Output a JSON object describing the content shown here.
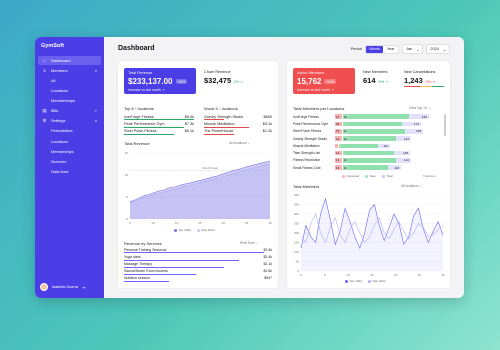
{
  "app": {
    "brand": "GymSoft",
    "page_title": "Dashboard"
  },
  "sidebar": {
    "items": [
      {
        "label": "Dashboard",
        "icon": "home-icon",
        "active": true
      },
      {
        "label": "Members",
        "icon": "users-icon",
        "chevron": "v"
      },
      {
        "label": "All",
        "sub": true
      },
      {
        "label": "Locations",
        "sub": true
      },
      {
        "label": "Memberships",
        "sub": true
      },
      {
        "label": "Bills",
        "icon": "file-icon",
        "chevron": ">"
      },
      {
        "label": "Settings",
        "icon": "gear-icon",
        "chevron": "v"
      },
      {
        "label": "Periodicities",
        "sub": true
      },
      {
        "label": "Locations",
        "sub": true
      },
      {
        "label": "Membeships",
        "sub": true
      },
      {
        "label": "Services",
        "sub": true
      },
      {
        "label": "Data feed",
        "sub": true
      }
    ],
    "user": {
      "name": "Isabella Guerra"
    }
  },
  "controls": {
    "period_label": "Period",
    "period_options": [
      "Month",
      "Year"
    ],
    "period_selected": "Month",
    "month_value": "Jan",
    "year_value": "2024"
  },
  "kpis_left": {
    "total_revenue": {
      "label": "Total Revenue",
      "value": "$233,137.00",
      "badge": "+32%",
      "sub": "Increase vs last month ↗"
    },
    "churn_revenue": {
      "label": "Churn Revenue",
      "value": "$32,475",
      "delta": "-2% ↘"
    }
  },
  "kpis_right": {
    "active_members": {
      "label": "Active Members",
      "value": "15,762",
      "badge": "+12%",
      "sub": "Increase vs last month ↗"
    },
    "new_members": {
      "label": "New Members",
      "value": "614",
      "delta": "+9% ↗"
    },
    "new_cancellations": {
      "label": "New Cancellations",
      "value": "1,243",
      "delta": "+6% ↗"
    }
  },
  "top_locations": {
    "title": "Top 5 ↑ locations",
    "rows": [
      {
        "name": "IronForge Fitness",
        "value": "$8.4k"
      },
      {
        "name": "Peak Performance Gym",
        "value": "$7.3k"
      },
      {
        "name": "Steel Pulse Fitness",
        "value": "$6.1k"
      }
    ]
  },
  "worst_locations": {
    "title": "Worst 5 ↓ locations",
    "rows": [
      {
        "name": "Gravity Strength Studio",
        "value": "$850"
      },
      {
        "name": "Muscle Meditation",
        "value": "$3.1k"
      },
      {
        "name": "The PowerHouse",
        "value": "$1.2k"
      }
    ]
  },
  "total_revenue_chart": {
    "title": "Total Revenue",
    "filter": "All locations",
    "annotation": "Month Goal",
    "legend": [
      "Jan 2024",
      "May 2024"
    ]
  },
  "revenue_by_services": {
    "title": "Revenue by Services",
    "filter": "Real Time",
    "rows": [
      {
        "name": "Personal Training Sessions",
        "value": "$2.9k"
      },
      {
        "name": "Yoga class",
        "value": "$2.4k"
      },
      {
        "name": "Massage Therapy",
        "value": "$2.1k"
      },
      {
        "name": "Sauna/Steam Room Access",
        "value": "$1.5k"
      },
      {
        "name": "Nutrition session",
        "value": "$947"
      }
    ]
  },
  "members_per_location": {
    "title": "Total Members per Locations",
    "view_label": "View",
    "view_value": "Top 10",
    "rows": [
      {
        "name": "IronForge Fitness",
        "c": "27",
        "n": "13",
        "t": "182"
      },
      {
        "name": "Peak Performance Gym",
        "c": "26",
        "n": "",
        "t": "174"
      },
      {
        "name": "Steel Pulse Fitness",
        "c": "15",
        "n": "11",
        "t": "168"
      },
      {
        "name": "Gravity Strength Studio",
        "c": "15",
        "n": "12",
        "t": "142"
      },
      {
        "name": "Muscle Meditation",
        "c": "",
        "n": "",
        "t": "111"
      },
      {
        "name": "Titan Strength Lab",
        "c": "14",
        "n": "",
        "t": "148"
      },
      {
        "name": "Fitness Revolution",
        "c": "11",
        "n": "10",
        "t": "142"
      },
      {
        "name": "Small Fitness Club",
        "c": "14",
        "n": "11",
        "t": "118"
      }
    ],
    "legend": [
      "Canceled",
      "New",
      "Total"
    ],
    "axis_end": "Transfers"
  },
  "total_members_chart": {
    "title": "Total Members",
    "filter": "All locations",
    "legend": [
      "Jan 2024",
      "May 2024"
    ]
  },
  "chart_data": [
    {
      "type": "area",
      "title": "Total Revenue",
      "x": [
        1,
        2,
        3,
        4,
        5,
        6,
        7,
        8,
        9,
        10,
        11,
        12,
        13,
        14,
        15,
        16,
        17,
        18,
        19,
        20,
        21,
        22,
        23,
        24,
        25,
        26,
        27,
        28,
        29,
        30
      ],
      "series": [
        {
          "name": "Jan 2024",
          "values": [
            4.2,
            4.6,
            5.1,
            5.7,
            6.0,
            6.4,
            6.8,
            7.0,
            7.5,
            7.7,
            8.0,
            8.4,
            8.6,
            8.9,
            9.2,
            9.5,
            9.8,
            10.1,
            10.4,
            10.8,
            11.2,
            11.6,
            11.9,
            12.2,
            12.6,
            12.9,
            13.2,
            13.5,
            13.8,
            14.0
          ]
        },
        {
          "name": "May 2024",
          "values": [
            4.0,
            4.3,
            4.7,
            5.2,
            5.5,
            5.9,
            6.2,
            6.5,
            6.9,
            7.1,
            7.4,
            7.8,
            8.0,
            8.3,
            8.6,
            8.9,
            9.2,
            9.5,
            9.8,
            10.1,
            10.5,
            10.9,
            11.2,
            11.5,
            11.9,
            12.2,
            12.5,
            12.8,
            13.1,
            13.4
          ]
        }
      ],
      "goal": 11.8,
      "xticks": [
        "0",
        "05",
        "10",
        "15",
        "20",
        "25",
        "30"
      ],
      "yticks": [
        "0",
        "5",
        "10",
        "15"
      ],
      "ylim": [
        0,
        16
      ]
    },
    {
      "type": "line",
      "title": "Total Members",
      "x": [
        1,
        2,
        3,
        4,
        5,
        6,
        7,
        8,
        9,
        10,
        11,
        12,
        13,
        14,
        15,
        16,
        17,
        18,
        19,
        20,
        21,
        22,
        23,
        24,
        25,
        26,
        27,
        28,
        29,
        30
      ],
      "series": [
        {
          "name": "Jan 2024",
          "values": [
            120,
            240,
            180,
            150,
            300,
            380,
            270,
            140,
            210,
            330,
            260,
            180,
            120,
            200,
            320,
            350,
            240,
            160,
            230,
            300,
            250,
            140,
            180,
            290,
            330,
            220,
            150,
            210,
            260,
            190
          ]
        },
        {
          "name": "May 2024",
          "values": [
            180,
            150,
            250,
            300,
            200,
            150,
            230,
            280,
            190,
            150,
            220,
            260,
            200,
            150,
            180,
            240,
            280,
            200,
            170,
            220,
            260,
            210,
            170,
            200,
            250,
            230,
            180,
            190,
            220,
            240
          ]
        }
      ],
      "xticks": [
        "0",
        "5",
        "10",
        "15",
        "20",
        "25",
        "30"
      ],
      "yticks": [
        "0",
        "50",
        "100",
        "150",
        "200",
        "250",
        "300",
        "350",
        "400"
      ],
      "ylim": [
        0,
        400
      ]
    }
  ],
  "colors": {
    "brand": "#4b3ee6",
    "danger": "#ef4f4f",
    "success": "#2aa86c",
    "accent": "#6c63ff"
  }
}
